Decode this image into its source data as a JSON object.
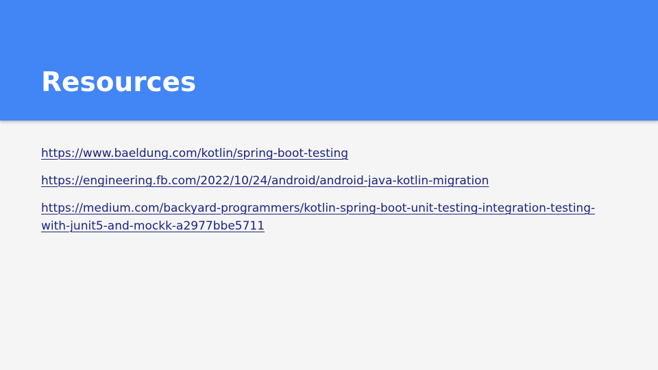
{
  "slide": {
    "title": "Resources",
    "links": [
      {
        "text": "https://www.baeldung.com/kotlin/spring-boot-testing"
      },
      {
        "text": "https://engineering.fb.com/2022/10/24/android/android-java-kotlin-migration"
      },
      {
        "text": "https://medium.com/backyard-programmers/kotlin-spring-boot-unit-testing-integration-testing-with-junit5-and-mockk-a2977bbe5711"
      }
    ]
  },
  "colors": {
    "header_background": "#4285f4",
    "title_text": "#ffffff",
    "slide_background": "#f5f5f5",
    "link_text": "#1a237e"
  }
}
